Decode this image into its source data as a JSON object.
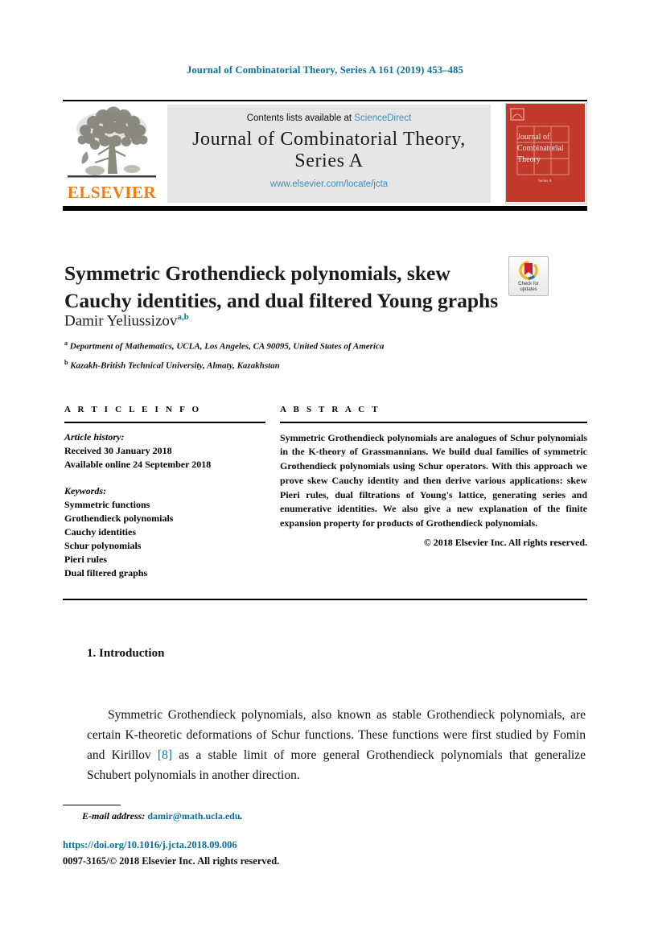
{
  "running_head": "Journal of Combinatorial Theory, Series A 161 (2019) 453–485",
  "masthead": {
    "contents_prefix": "Contents lists available at",
    "sciencedirect": "ScienceDirect",
    "journal_name_line1": "Journal of Combinatorial Theory,",
    "journal_name_line2": "Series A",
    "journal_url": "www.elsevier.com/locate/jcta",
    "publisher": "ELSEVIER",
    "cover_title_line1": "Journal of",
    "cover_title_line2": "Combinatorial",
    "cover_title_line3": "Theory",
    "cover_subtitle": "Series A"
  },
  "article": {
    "title": "Symmetric Grothendieck polynomials, skew Cauchy identities, and dual filtered Young graphs",
    "author": "Damir Yeliussizov",
    "author_marks": "a,b",
    "affiliations": [
      {
        "mark": "a",
        "text": "Department of Mathematics, UCLA, Los Angeles, CA 90095, United States of America"
      },
      {
        "mark": "b",
        "text": "Kazakh-British Technical University, Almaty, Kazakhstan"
      }
    ]
  },
  "crossmark": {
    "line1": "Check for",
    "line2": "updates"
  },
  "info": {
    "heading": "A R T I C L E   I N F O",
    "history_label": "Article history:",
    "received": "Received 30 January 2018",
    "available": "Available online 24 September 2018",
    "keywords_label": "Keywords:",
    "keywords": [
      "Symmetric functions",
      "Grothendieck polynomials",
      "Cauchy identities",
      "Schur polynomials",
      "Pieri rules",
      "Dual filtered graphs"
    ]
  },
  "abstract": {
    "heading": "A B S T R A C T",
    "text": "Symmetric Grothendieck polynomials are analogues of Schur polynomials in the K-theory of Grassmannians. We build dual families of symmetric Grothendieck polynomials using Schur operators. With this approach we prove skew Cauchy identity and then derive various applications: skew Pieri rules, dual filtrations of Young's lattice, generating series and enumerative identities. We also give a new explanation of the finite expansion property for products of Grothendieck polynomials.",
    "copyright": "© 2018 Elsevier Inc. All rights reserved."
  },
  "body": {
    "section_number_title": "1.  Introduction",
    "paragraph_part1": "Symmetric Grothendieck polynomials, also known as stable Grothendieck polynomials, are certain K-theoretic deformations of Schur functions. These functions were first studied by Fomin and Kirillov ",
    "reference": "[8]",
    "paragraph_part2": " as a stable limit of more general Grothendieck polynomials that generalize Schubert polynomials in another direction."
  },
  "footer": {
    "email_label": "E-mail address:",
    "email_address": "damir@math.ucla.edu",
    "email_period": ".",
    "doi": "https://doi.org/10.1016/j.jcta.2018.09.006",
    "issn_line": "0097-3165/© 2018 Elsevier Inc. All rights reserved."
  },
  "colors": {
    "link": "#0b7099",
    "sciencedirect": "#3a8fbf",
    "elsevier_orange": "#ef7d18",
    "cover_red": "#c0392b",
    "masthead_bg": "#e6e6e6"
  }
}
